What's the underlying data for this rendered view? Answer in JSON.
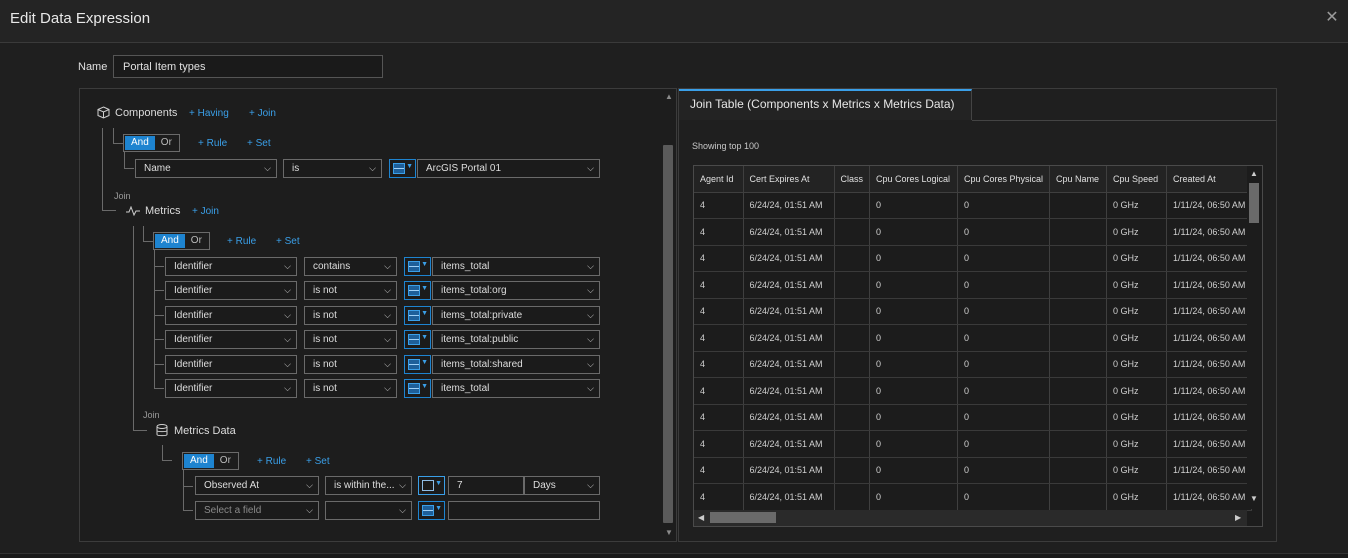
{
  "dialog": {
    "title": "Edit Data Expression",
    "close_icon": "close-icon"
  },
  "name_field": {
    "label": "Name",
    "value": "Portal Item types"
  },
  "query": {
    "components": {
      "label": "Components",
      "having": "Having",
      "join": "Join",
      "andor": {
        "and": "And",
        "or": "Or",
        "selected": "And"
      },
      "rule": "Rule",
      "set": "Set",
      "rules": [
        {
          "field": "Name",
          "op": "is",
          "value": "ArcGIS Portal 01"
        }
      ]
    },
    "metrics": {
      "join_label": "Join",
      "label": "Metrics",
      "join": "Join",
      "andor": {
        "and": "And",
        "or": "Or",
        "selected": "And"
      },
      "rule": "Rule",
      "set": "Set",
      "rules": [
        {
          "field": "Identifier",
          "op": "contains",
          "value": "items_total"
        },
        {
          "field": "Identifier",
          "op": "is not",
          "value": "items_total:org"
        },
        {
          "field": "Identifier",
          "op": "is not",
          "value": "items_total:private"
        },
        {
          "field": "Identifier",
          "op": "is not",
          "value": "items_total:public"
        },
        {
          "field": "Identifier",
          "op": "is not",
          "value": "items_total:shared"
        },
        {
          "field": "Identifier",
          "op": "is not",
          "value": "items_total"
        }
      ]
    },
    "metrics_data": {
      "join_label": "Join",
      "label": "Metrics Data",
      "andor": {
        "and": "And",
        "or": "Or",
        "selected": "And"
      },
      "rule": "Rule",
      "set": "Set",
      "rules": [
        {
          "field": "Observed At",
          "op": "is within the...",
          "value": "7",
          "unit": "Days"
        },
        {
          "field": "Select a field",
          "op": "",
          "value": ""
        }
      ]
    }
  },
  "join_table": {
    "tab_label": "Join Table (Components x Metrics x Metrics Data)",
    "showing": "Showing top 100",
    "columns": [
      "Agent Id",
      "Cert Expires At",
      "Class",
      "Cpu Cores Logical",
      "Cpu Cores Physical",
      "Cpu Name",
      "Cpu Speed",
      "Created At"
    ],
    "rows": [
      [
        "4",
        "6/24/24, 01:51 AM",
        "",
        "0",
        "0",
        "",
        "0 GHz",
        "1/11/24, 06:50 AM"
      ],
      [
        "4",
        "6/24/24, 01:51 AM",
        "",
        "0",
        "0",
        "",
        "0 GHz",
        "1/11/24, 06:50 AM"
      ],
      [
        "4",
        "6/24/24, 01:51 AM",
        "",
        "0",
        "0",
        "",
        "0 GHz",
        "1/11/24, 06:50 AM"
      ],
      [
        "4",
        "6/24/24, 01:51 AM",
        "",
        "0",
        "0",
        "",
        "0 GHz",
        "1/11/24, 06:50 AM"
      ],
      [
        "4",
        "6/24/24, 01:51 AM",
        "",
        "0",
        "0",
        "",
        "0 GHz",
        "1/11/24, 06:50 AM"
      ],
      [
        "4",
        "6/24/24, 01:51 AM",
        "",
        "0",
        "0",
        "",
        "0 GHz",
        "1/11/24, 06:50 AM"
      ],
      [
        "4",
        "6/24/24, 01:51 AM",
        "",
        "0",
        "0",
        "",
        "0 GHz",
        "1/11/24, 06:50 AM"
      ],
      [
        "4",
        "6/24/24, 01:51 AM",
        "",
        "0",
        "0",
        "",
        "0 GHz",
        "1/11/24, 06:50 AM"
      ],
      [
        "4",
        "6/24/24, 01:51 AM",
        "",
        "0",
        "0",
        "",
        "0 GHz",
        "1/11/24, 06:50 AM"
      ],
      [
        "4",
        "6/24/24, 01:51 AM",
        "",
        "0",
        "0",
        "",
        "0 GHz",
        "1/11/24, 06:50 AM"
      ],
      [
        "4",
        "6/24/24, 01:51 AM",
        "",
        "0",
        "0",
        "",
        "0 GHz",
        "1/11/24, 06:50 AM"
      ],
      [
        "4",
        "6/24/24, 01:51 AM",
        "",
        "0",
        "0",
        "",
        "0 GHz",
        "1/11/24, 06:50 AM"
      ]
    ]
  },
  "colors": {
    "accent": "#1e84d0",
    "link": "#3a9fe8",
    "background": "#1f1f1f"
  }
}
